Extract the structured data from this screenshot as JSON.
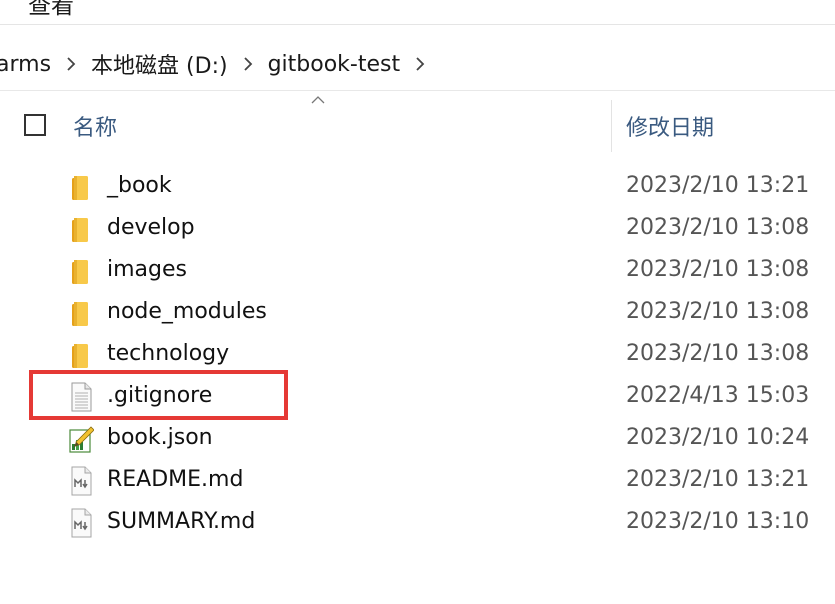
{
  "menu": {
    "view_label": "查看"
  },
  "breadcrumb": [
    "arms",
    "本地磁盘 (D:)",
    "gitbook-test"
  ],
  "columns": {
    "name": "名称",
    "date": "修改日期"
  },
  "files": [
    {
      "name": "_book",
      "date": "2023/2/10 13:21",
      "icon": "folder-icon"
    },
    {
      "name": "develop",
      "date": "2023/2/10 13:08",
      "icon": "folder-icon"
    },
    {
      "name": "images",
      "date": "2023/2/10 13:08",
      "icon": "folder-icon"
    },
    {
      "name": "node_modules",
      "date": "2023/2/10 13:08",
      "icon": "folder-icon"
    },
    {
      "name": "technology",
      "date": "2023/2/10 13:08",
      "icon": "folder-icon"
    },
    {
      "name": ".gitignore",
      "date": "2022/4/13 15:03",
      "icon": "text-file-icon"
    },
    {
      "name": "book.json",
      "date": "2023/2/10 10:24",
      "icon": "json-file-icon"
    },
    {
      "name": "README.md",
      "date": "2023/2/10 13:21",
      "icon": "markdown-file-icon"
    },
    {
      "name": "SUMMARY.md",
      "date": "2023/2/10 13:10",
      "icon": "markdown-file-icon"
    }
  ],
  "highlight_color": "#e53935"
}
